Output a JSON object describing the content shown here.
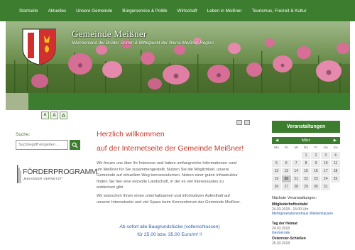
{
  "nav": {
    "items": [
      "Startseite",
      "Aktuelles",
      "Unsere Gemeinde",
      "Bürgerservice & Politik",
      "Wirtschaft",
      "Leben in Meißner",
      "Tourismus, Freizeit & Kultur"
    ]
  },
  "banner": {
    "title": "Gemeinde Meißner",
    "subtitle": "Märchenland der Brüder Grimm & Mittelpunkt der Werra-Meißner-Region"
  },
  "font_size": {
    "small": "A",
    "medium": "A",
    "large": "A"
  },
  "search": {
    "label": "Suche:",
    "placeholder": "Suchbegriff eingeben ..."
  },
  "promo_logo": {
    "main": "FÖRDERPROGRAMM",
    "sub": "„MEISSNER VERNETZT“"
  },
  "content": {
    "heading": "Herzlich willkommen",
    "subheading": "auf der Internetseite der Gemeinde Meißner!",
    "para1": "Wir freuen uns über Ihr Interesse und haben umfangreiche Informationen rund um Meißner für Sie zusammengestellt. Nutzen Sie die Möglichkeit, unsere Gemeinde auf virtuellem Weg kennenzulernen. Neben einer guten Infrastruktur finden Sie hier eine reizvolle Landschaft, in der es viel Interessantes zu entdecken gibt.",
    "para2": "Wir wünschen Ihnen einen unterhaltsamen und informativen Aufenthalt auf unserer Internetseite und viel Spass beim Kennenlernen der Gemeinde Meißner.",
    "offer_line1": "Ab sofort alle Baugrundstücke (vollerschlossen)",
    "offer_line2": "für 25,00 bzw. 35,00 Euro/m² !!"
  },
  "sidebar": {
    "events_button": "Veranstaltungen",
    "calendar": {
      "month": "März",
      "prev": "◀",
      "next": "▶",
      "weekdays": [
        "Mo",
        "Di",
        "Mi",
        "Do",
        "Fr",
        "Sa",
        "So"
      ],
      "days": [
        "",
        "",
        "",
        "1",
        "2",
        "3",
        "4",
        "5",
        "6",
        "7",
        "8",
        "9",
        "10",
        "11",
        "12",
        "13",
        "14",
        "15",
        "16",
        "17",
        "18",
        "19",
        "20",
        "21",
        "22",
        "23",
        "24",
        "25",
        "26",
        "27",
        "28",
        "29",
        "30",
        "31",
        "",
        ""
      ],
      "today": "20"
    },
    "next_label": "Nächste Veranstaltungen:",
    "events": [
      {
        "title": "Mitgliederhoffesttafel",
        "date": "24.03.2018 - 15:00 Uhr",
        "place": "Mehrgenerationenhaus Weidenhausen"
      },
      {
        "title": "Tag der Heimat",
        "date": "24.03.2018",
        "place": "Germerode"
      },
      {
        "title": "Osterreier-Schießen",
        "date": "25.03.2018",
        "place": ""
      }
    ]
  },
  "colors": {
    "brand_green": "#3d7d2f",
    "heading_red": "#c0392b",
    "link_blue": "#2a5fa8"
  }
}
